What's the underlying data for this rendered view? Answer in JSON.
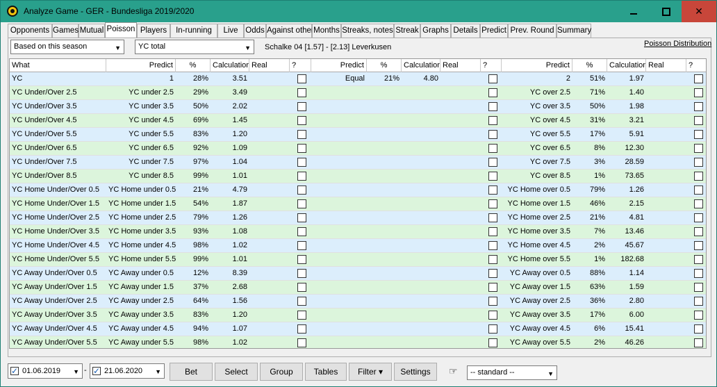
{
  "window": {
    "title": "Analyze Game - GER - Bundesliga 2019/2020",
    "min_icon": "minimize-icon",
    "max_icon": "maximize-icon",
    "close_icon": "close-icon"
  },
  "tabs": [
    {
      "label": "Opponents"
    },
    {
      "label": "Games"
    },
    {
      "label": "Mutual"
    },
    {
      "label": "Poisson",
      "active": true
    },
    {
      "label": "Players"
    },
    {
      "label": "In-running"
    },
    {
      "label": "Live"
    },
    {
      "label": "Odds"
    },
    {
      "label": "Against other"
    },
    {
      "label": "Months"
    },
    {
      "label": "Streaks, notes"
    },
    {
      "label": "Streak"
    },
    {
      "label": "Graphs"
    },
    {
      "label": "Details"
    },
    {
      "label": "Predict"
    },
    {
      "label": "Prev. Round"
    },
    {
      "label": "Summary"
    }
  ],
  "filters": {
    "season_select": "Based on this season",
    "type_select": "YC total",
    "match_info": "Schalke 04 [1.57] - [2.13] Leverkusen",
    "poisson_link": "Poisson Distribution"
  },
  "headers": [
    "What",
    "Predict",
    "%",
    "Calculation",
    "Real",
    "?",
    "Predict",
    "%",
    "Calculation",
    "Real",
    "?",
    "Predict",
    "%",
    "Calculation",
    "Real",
    "?"
  ],
  "rows": [
    {
      "what": "YC",
      "p1": "1",
      "pct1": "28%",
      "c1": "3.51",
      "p2": "Equal",
      "pct2": "21%",
      "c2": "4.80",
      "p3": "2",
      "pct3": "51%",
      "c3": "1.97"
    },
    {
      "what": "YC Under/Over 2.5",
      "p1": "YC under 2.5",
      "pct1": "29%",
      "c1": "3.49",
      "p2": "",
      "pct2": "",
      "c2": "",
      "p3": "YC over 2.5",
      "pct3": "71%",
      "c3": "1.40"
    },
    {
      "what": "YC Under/Over 3.5",
      "p1": "YC under 3.5",
      "pct1": "50%",
      "c1": "2.02",
      "p2": "",
      "pct2": "",
      "c2": "",
      "p3": "YC over 3.5",
      "pct3": "50%",
      "c3": "1.98"
    },
    {
      "what": "YC Under/Over 4.5",
      "p1": "YC under 4.5",
      "pct1": "69%",
      "c1": "1.45",
      "p2": "",
      "pct2": "",
      "c2": "",
      "p3": "YC over 4.5",
      "pct3": "31%",
      "c3": "3.21"
    },
    {
      "what": "YC Under/Over 5.5",
      "p1": "YC under 5.5",
      "pct1": "83%",
      "c1": "1.20",
      "p2": "",
      "pct2": "",
      "c2": "",
      "p3": "YC over 5.5",
      "pct3": "17%",
      "c3": "5.91"
    },
    {
      "what": "YC Under/Over 6.5",
      "p1": "YC under 6.5",
      "pct1": "92%",
      "c1": "1.09",
      "p2": "",
      "pct2": "",
      "c2": "",
      "p3": "YC over 6.5",
      "pct3": "8%",
      "c3": "12.30"
    },
    {
      "what": "YC Under/Over 7.5",
      "p1": "YC under 7.5",
      "pct1": "97%",
      "c1": "1.04",
      "p2": "",
      "pct2": "",
      "c2": "",
      "p3": "YC over 7.5",
      "pct3": "3%",
      "c3": "28.59"
    },
    {
      "what": "YC Under/Over 8.5",
      "p1": "YC under 8.5",
      "pct1": "99%",
      "c1": "1.01",
      "p2": "",
      "pct2": "",
      "c2": "",
      "p3": "YC over 8.5",
      "pct3": "1%",
      "c3": "73.65"
    },
    {
      "what": "YC Home Under/Over 0.5",
      "p1": "YC Home under 0.5",
      "pct1": "21%",
      "c1": "4.79",
      "p2": "",
      "pct2": "",
      "c2": "",
      "p3": "YC Home over 0.5",
      "pct3": "79%",
      "c3": "1.26"
    },
    {
      "what": "YC Home Under/Over 1.5",
      "p1": "YC Home under 1.5",
      "pct1": "54%",
      "c1": "1.87",
      "p2": "",
      "pct2": "",
      "c2": "",
      "p3": "YC Home over 1.5",
      "pct3": "46%",
      "c3": "2.15"
    },
    {
      "what": "YC Home Under/Over 2.5",
      "p1": "YC Home under 2.5",
      "pct1": "79%",
      "c1": "1.26",
      "p2": "",
      "pct2": "",
      "c2": "",
      "p3": "YC Home over 2.5",
      "pct3": "21%",
      "c3": "4.81"
    },
    {
      "what": "YC Home Under/Over 3.5",
      "p1": "YC Home under 3.5",
      "pct1": "93%",
      "c1": "1.08",
      "p2": "",
      "pct2": "",
      "c2": "",
      "p3": "YC Home over 3.5",
      "pct3": "7%",
      "c3": "13.46"
    },
    {
      "what": "YC Home Under/Over 4.5",
      "p1": "YC Home under 4.5",
      "pct1": "98%",
      "c1": "1.02",
      "p2": "",
      "pct2": "",
      "c2": "",
      "p3": "YC Home over 4.5",
      "pct3": "2%",
      "c3": "45.67"
    },
    {
      "what": "YC Home Under/Over 5.5",
      "p1": "YC Home under 5.5",
      "pct1": "99%",
      "c1": "1.01",
      "p2": "",
      "pct2": "",
      "c2": "",
      "p3": "YC Home over 5.5",
      "pct3": "1%",
      "c3": "182.68"
    },
    {
      "what": "YC Away Under/Over 0.5",
      "p1": "YC Away under 0.5",
      "pct1": "12%",
      "c1": "8.39",
      "p2": "",
      "pct2": "",
      "c2": "",
      "p3": "YC Away over 0.5",
      "pct3": "88%",
      "c3": "1.14"
    },
    {
      "what": "YC Away Under/Over 1.5",
      "p1": "YC Away under 1.5",
      "pct1": "37%",
      "c1": "2.68",
      "p2": "",
      "pct2": "",
      "c2": "",
      "p3": "YC Away over 1.5",
      "pct3": "63%",
      "c3": "1.59"
    },
    {
      "what": "YC Away Under/Over 2.5",
      "p1": "YC Away under 2.5",
      "pct1": "64%",
      "c1": "1.56",
      "p2": "",
      "pct2": "",
      "c2": "",
      "p3": "YC Away over 2.5",
      "pct3": "36%",
      "c3": "2.80"
    },
    {
      "what": "YC Away Under/Over 3.5",
      "p1": "YC Away under 3.5",
      "pct1": "83%",
      "c1": "1.20",
      "p2": "",
      "pct2": "",
      "c2": "",
      "p3": "YC Away over 3.5",
      "pct3": "17%",
      "c3": "6.00"
    },
    {
      "what": "YC Away Under/Over 4.5",
      "p1": "YC Away under 4.5",
      "pct1": "94%",
      "c1": "1.07",
      "p2": "",
      "pct2": "",
      "c2": "",
      "p3": "YC Away over 4.5",
      "pct3": "6%",
      "c3": "15.41"
    },
    {
      "what": "YC Away Under/Over 5.5",
      "p1": "YC Away under 5.5",
      "pct1": "98%",
      "c1": "1.02",
      "p2": "",
      "pct2": "",
      "c2": "",
      "p3": "YC Away over 5.5",
      "pct3": "2%",
      "c3": "46.26"
    }
  ],
  "bottom": {
    "date_from": "01.06.2019",
    "date_sep": "-",
    "date_to": "21.06.2020",
    "buttons": [
      "Bet",
      "Select",
      "Group",
      "Tables",
      "Filter ▾",
      "Settings"
    ],
    "hand_icon": "pointing-hand-icon",
    "standard_select": "-- standard --"
  },
  "colors": {
    "titlebar": "#29a08c",
    "close_button": "#c8463a",
    "row_blue": "#dceefc",
    "row_green": "#dcf5dc"
  }
}
